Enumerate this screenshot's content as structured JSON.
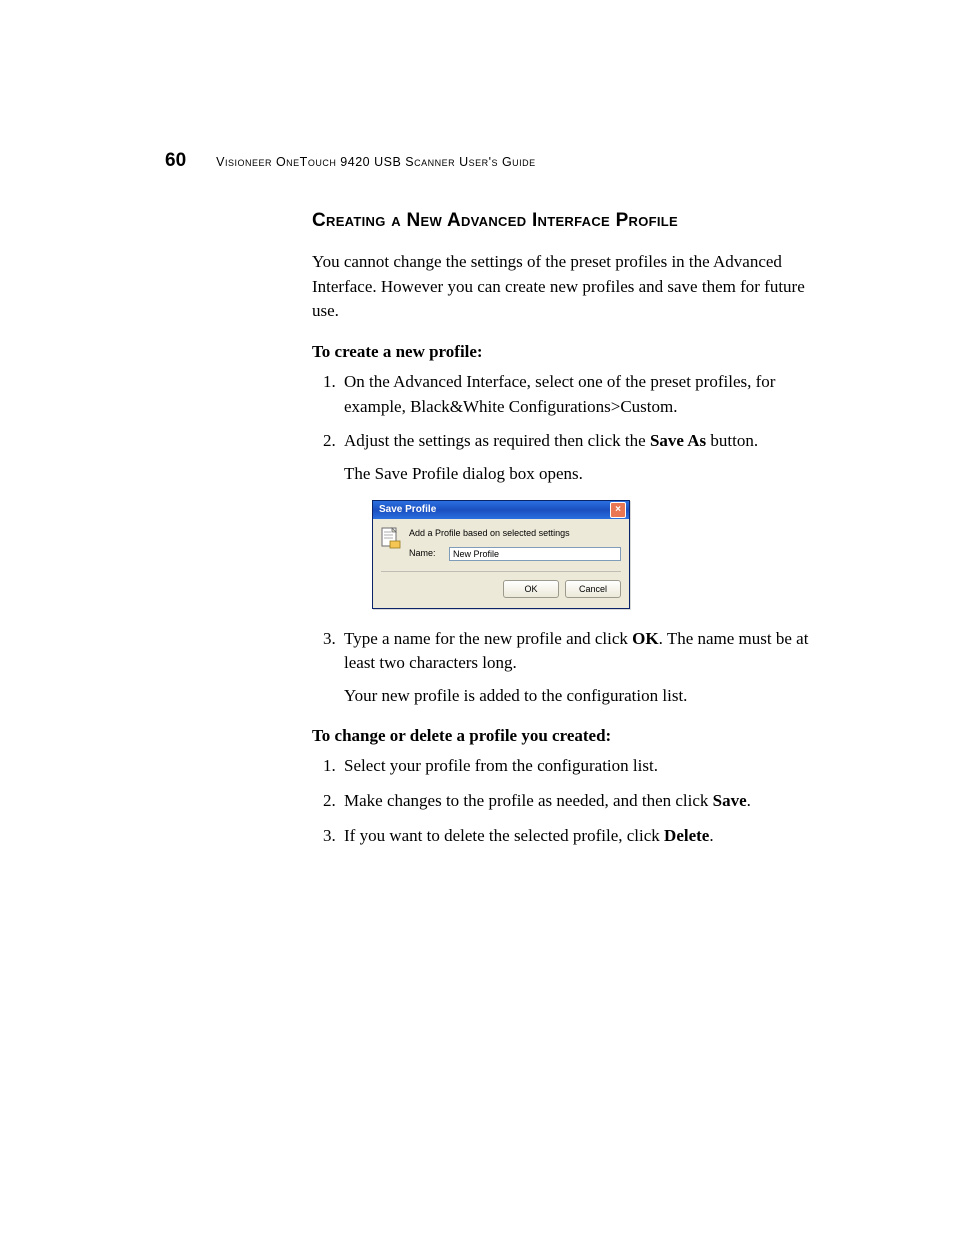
{
  "header": {
    "page_number": "60",
    "guide_title": "Visioneer OneTouch 9420 USB Scanner User's Guide"
  },
  "section": {
    "heading": "Creating a New Advanced Interface Profile",
    "intro": "You cannot change the settings of the preset profiles in the Advanced Interface. However you can create new profiles and save them for future use."
  },
  "create": {
    "subheading": "To create a new profile:",
    "step1": "On the Advanced Interface, select one of the preset profiles, for example, Black&White Configurations>Custom.",
    "step2_pre": "Adjust the settings as required then click the ",
    "step2_bold": "Save As",
    "step2_post": " button.",
    "step2_detail": "The Save Profile dialog box opens.",
    "step3_pre": "Type a name for the new profile and click ",
    "step3_bold": "OK",
    "step3_post": ". The name must be at least two characters long.",
    "step3_detail": "Your new profile is added to the configuration list."
  },
  "dialog": {
    "title": "Save Profile",
    "description": "Add a Profile based on selected settings",
    "name_label": "Name:",
    "name_value": "New Profile",
    "ok": "OK",
    "cancel": "Cancel"
  },
  "change": {
    "subheading": "To change or delete a profile you created:",
    "step1": "Select your profile from the configuration list.",
    "step2_pre": "Make changes to the profile as needed, and then click ",
    "step2_bold": "Save",
    "step2_post": ".",
    "step3_pre": "If you want to delete the selected profile, click ",
    "step3_bold": "Delete",
    "step3_post": "."
  }
}
